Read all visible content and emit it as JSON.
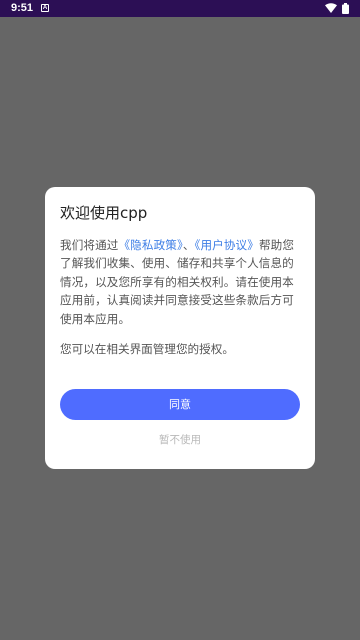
{
  "status_bar": {
    "time": "9:51",
    "notification_icon": "A"
  },
  "dialog": {
    "title": "欢迎使用cpp",
    "body_prefix": "我们将通过",
    "privacy_policy_link": "《隐私政策》",
    "separator": "、",
    "user_agreement_link": "《用户协议》",
    "body_suffix": "帮助您了解我们收集、使用、储存和共享个人信息的情况，以及您所享有的相关权利。请在使用本应用前，认真阅读并同意接受这些条款后方可使用本应用。",
    "note": "您可以在相关界面管理您的授权。",
    "agree_label": "同意",
    "decline_label": "暂不使用"
  },
  "colors": {
    "accent": "#4f6cff",
    "link": "#3d7ee6",
    "overlay": "#666666",
    "status_bar": "#2c0f55"
  }
}
